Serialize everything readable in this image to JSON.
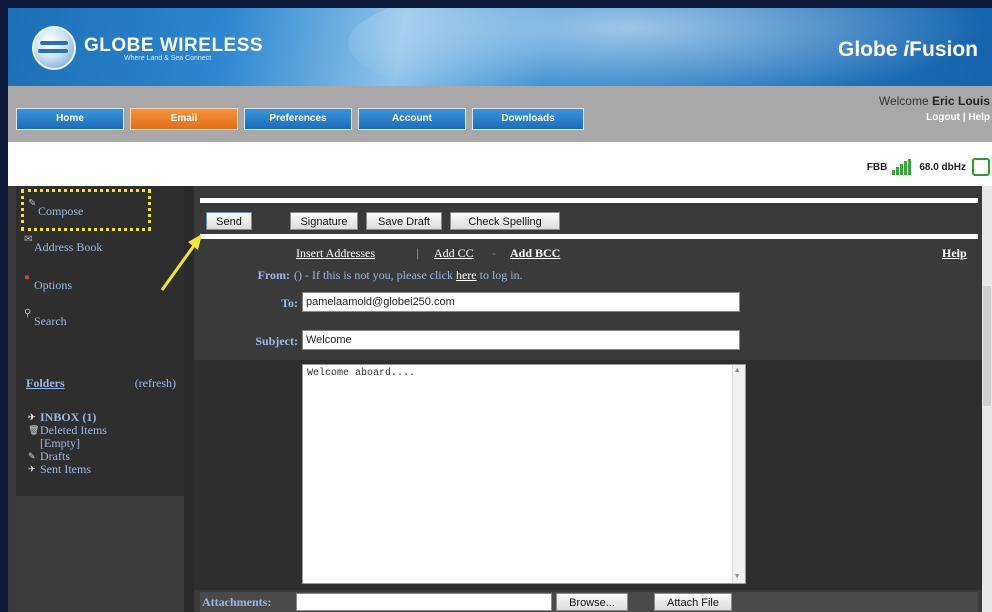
{
  "header": {
    "logo_name": "GLOBE WIRELESS",
    "logo_tagline": "Where Land & Sea Connect",
    "brand": "Globe iFusion"
  },
  "nav": {
    "tabs": [
      "Home",
      "Email",
      "Preferences",
      "Account",
      "Downloads"
    ],
    "active_tab": "Email",
    "welcome_prefix": "Welcome",
    "user_name": "Eric Louis",
    "logout": "Logout",
    "help": "Help"
  },
  "status": {
    "network": "FBB",
    "signal": "68.0 dbHz"
  },
  "sidebar": {
    "items": [
      "Compose",
      "Address Book",
      "Options",
      "Search"
    ],
    "folders_label": "Folders",
    "refresh_label": "(refresh)",
    "folders": [
      "INBOX (1)",
      "Deleted Items",
      "[Empty]",
      "Drafts",
      "Sent Items"
    ]
  },
  "toolbar": {
    "send": "Send",
    "signature": "Signature",
    "save_draft": "Save Draft",
    "check_spelling": "Check Spelling"
  },
  "compose": {
    "insert_addresses": "Insert Addresses",
    "add_cc": "Add CC",
    "add_bcc": "Add BCC",
    "help": "Help",
    "from_label": "From:",
    "from_text_before": "() - If this is not you, please click",
    "from_link": "here",
    "from_text_after": "to log in.",
    "to_label": "To:",
    "to_value": "pamelaamold@globei250.com",
    "subject_label": "Subject:",
    "subject_value": "Welcome",
    "body": "Welcome aboard....",
    "attachments_label": "Attachments:",
    "browse": "Browse...",
    "attach_file": "Attach File"
  },
  "colors": {
    "accent_blue": "#1c6db8",
    "active_orange": "#e2701a",
    "highlight_yellow": "#f0e030"
  }
}
